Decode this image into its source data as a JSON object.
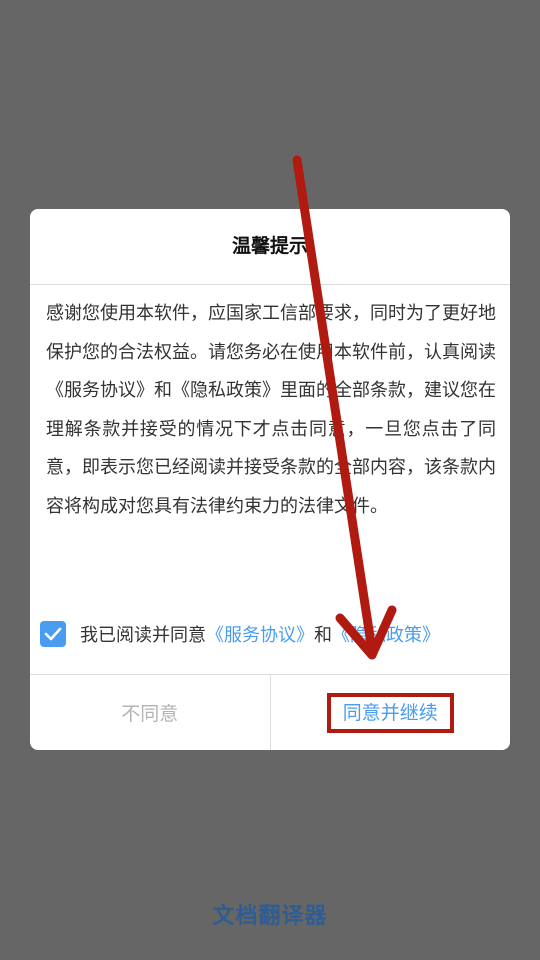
{
  "app": {
    "name": "文档翻译器"
  },
  "dialog": {
    "title": "温馨提示",
    "body": "感谢您使用本软件，应国家工信部要求，同时为了更好地保护您的合法权益。请您务必在使用本软件前，认真阅读《服务协议》和《隐私政策》里面的全部条款，建议您在理解条款并接受的情况下才点击同意，一旦您点击了同意，即表示您已经阅读并接受条款的全部内容，该条款内容将构成对您具有法律约束力的法律文件。",
    "agreement": {
      "checked": true,
      "prefix": "我已阅读并同意",
      "service_link": "《服务协议》",
      "conjunction": "和",
      "privacy_link": "《隐私政策》"
    },
    "buttons": {
      "disagree": "不同意",
      "agree": "同意并继续"
    }
  },
  "colors": {
    "overlay": "#666666",
    "accent": "#4a9cf0",
    "annotation": "#b01a10",
    "app_name": "#2f5d93"
  }
}
